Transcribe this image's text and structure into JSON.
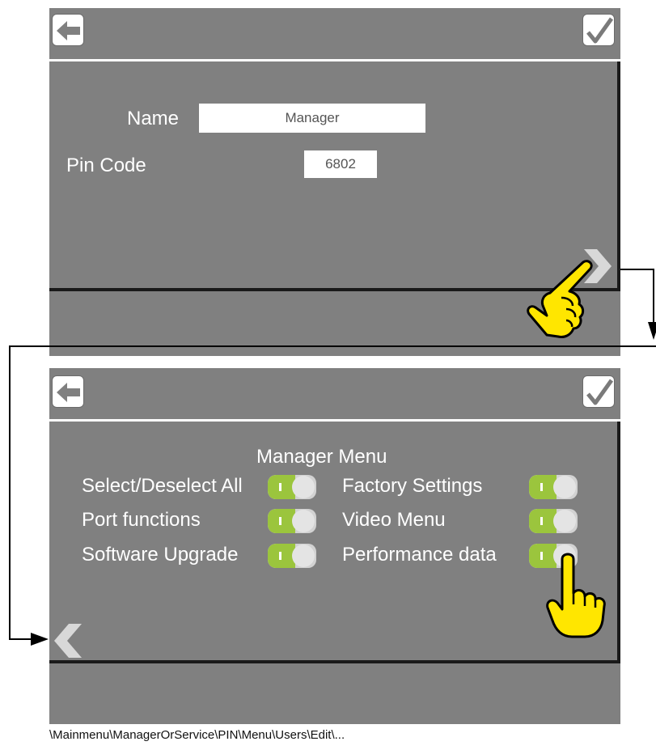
{
  "screen1": {
    "back_icon": "arrow-left-icon",
    "confirm_icon": "checkmark-icon",
    "name_label": "Name",
    "name_value": "Manager",
    "pin_label": "Pin Code",
    "pin_value": "6802",
    "next_icon": "chevron-right-icon"
  },
  "screen2": {
    "back_icon": "arrow-left-icon",
    "confirm_icon": "checkmark-icon",
    "menu_title": "Manager Menu",
    "toggles": [
      {
        "label": "Select/Deselect All",
        "on": true
      },
      {
        "label": "Port functions",
        "on": true
      },
      {
        "label": "Software Upgrade",
        "on": true
      },
      {
        "label": "Factory Settings",
        "on": true
      },
      {
        "label": "Video Menu",
        "on": true
      },
      {
        "label": "Performance data",
        "on": true
      }
    ],
    "prev_icon": "chevron-left-icon"
  },
  "colors": {
    "screen_bg": "#808080",
    "toggle_on": "#9bc53d",
    "hand_pointer": "#ffe600"
  },
  "footer_path": "\\Mainmenu\\ManagerOrService\\PIN\\Menu\\Users\\Edit\\..."
}
